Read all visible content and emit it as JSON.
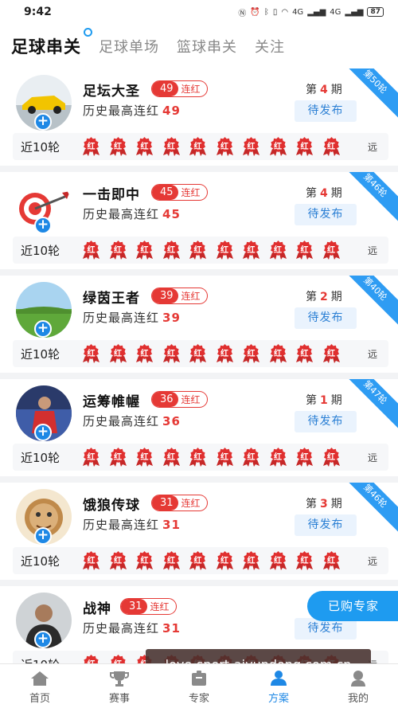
{
  "status": {
    "time": "9:42",
    "signal_a": "4G",
    "signal_b": "4G",
    "battery": "87"
  },
  "tabs": [
    {
      "label": "足球串关"
    },
    {
      "label": "足球单场"
    },
    {
      "label": "篮球串关"
    },
    {
      "label": "关注"
    }
  ],
  "labels": {
    "streak": "连红",
    "best": "历史最高连红",
    "issue_prefix": "第",
    "issue_suffix": "期",
    "pending": "待发布",
    "recent": "近10轮",
    "hong": "红",
    "far": "远"
  },
  "experts": [
    {
      "name": "足坛大圣",
      "streak": "49",
      "best": "49",
      "issue": "4",
      "ribbon": "第50轮"
    },
    {
      "name": "一击即中",
      "streak": "45",
      "best": "45",
      "issue": "4",
      "ribbon": "第46轮"
    },
    {
      "name": "绿茵王者",
      "streak": "39",
      "best": "39",
      "issue": "2",
      "ribbon": "第40轮"
    },
    {
      "name": "运筹帷幄",
      "streak": "36",
      "best": "36",
      "issue": "1",
      "ribbon": "第47轮"
    },
    {
      "name": "饿狼传球",
      "streak": "31",
      "best": "31",
      "issue": "3",
      "ribbon": "第46轮"
    },
    {
      "name": "战神",
      "streak": "31",
      "best": "31",
      "issue": "",
      "ribbon": ""
    }
  ],
  "float_button": "已购专家",
  "watermark": "love-sport-aiyundong.com.cn",
  "nav": [
    {
      "label": "首页",
      "icon": "home-icon"
    },
    {
      "label": "赛事",
      "icon": "trophy-icon"
    },
    {
      "label": "专家",
      "icon": "expert-icon"
    },
    {
      "label": "方案",
      "icon": "plan-icon"
    },
    {
      "label": "我的",
      "icon": "profile-icon"
    }
  ],
  "colors": {
    "accent": "#1e88e5",
    "red": "#e53935",
    "ribbon": "#2e9cf3"
  }
}
